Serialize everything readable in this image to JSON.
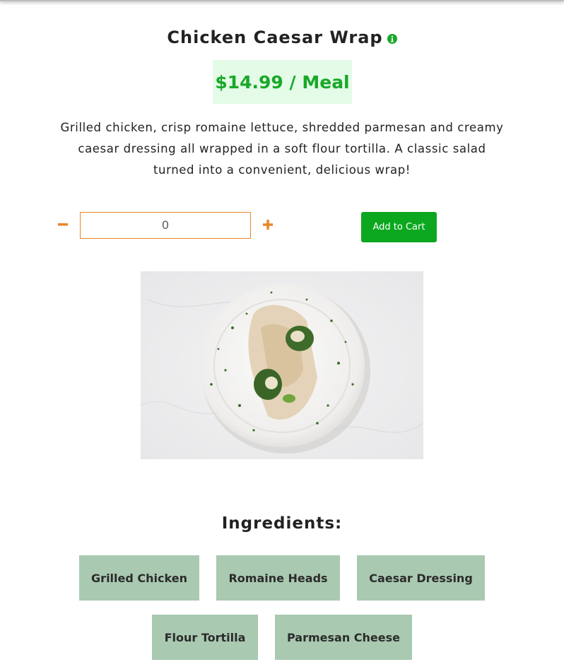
{
  "product": {
    "title": "Chicken Caesar Wrap",
    "info_icon": "info-circle-icon",
    "price": "$14.99 / Meal",
    "description": "Grilled chicken, crisp romaine lettuce, shredded parmesan and creamy caesar dressing all wrapped in a soft flour tortilla. A classic salad turned into a convenient, delicious wrap!"
  },
  "order": {
    "decrement_icon": "minus-icon",
    "quantity": "0",
    "increment_icon": "plus-icon",
    "add_to_cart_label": "Add to Cart"
  },
  "image": {
    "subject": "chicken-caesar-wrap-on-plate"
  },
  "ingredients": {
    "heading": "Ingredients:",
    "items": [
      {
        "label": "Grilled Chicken"
      },
      {
        "label": "Romaine Heads"
      },
      {
        "label": "Caesar Dressing"
      },
      {
        "label": "Flour Tortilla"
      },
      {
        "label": "Parmesan Cheese"
      }
    ]
  },
  "colors": {
    "price_text": "#19a829",
    "price_bg": "#e4fbe8",
    "accent_orange": "#e8862a",
    "button_green": "#0ba81f",
    "ingredient_bg": "#a9c9b1"
  }
}
